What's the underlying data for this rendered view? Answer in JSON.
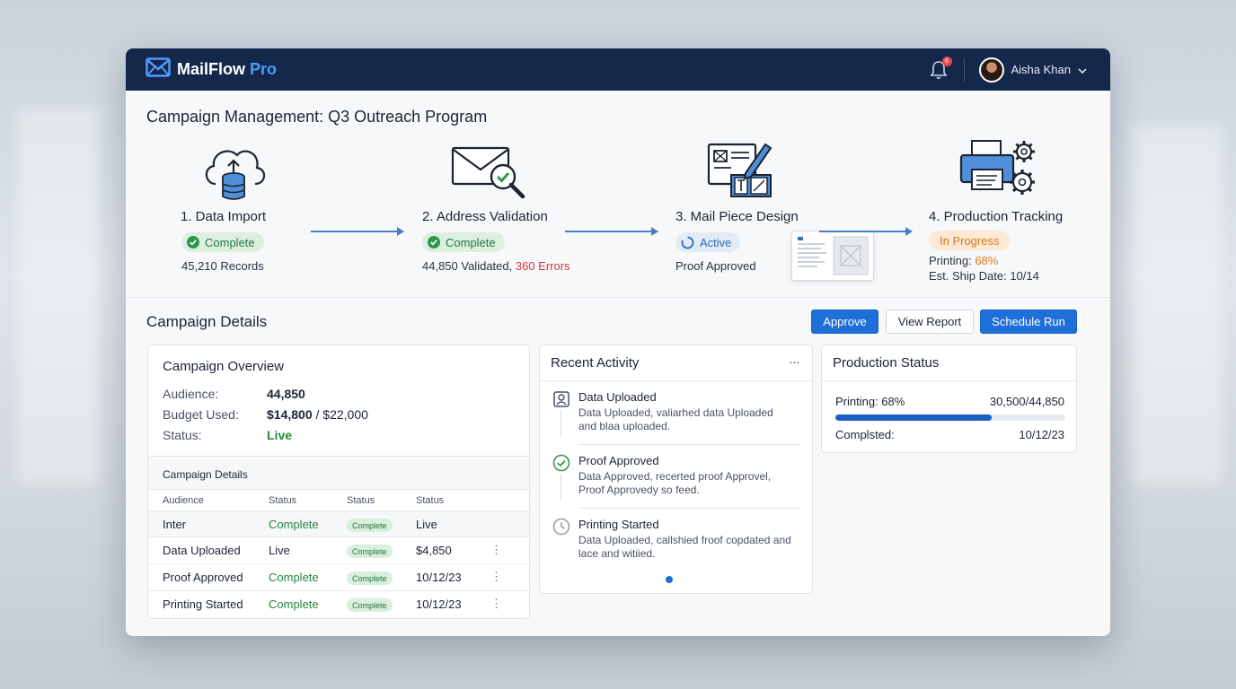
{
  "app": {
    "name": "MailFlow",
    "name_suffix": "Pro",
    "notification_count": "6",
    "user_name": "Aisha Khan"
  },
  "page": {
    "title": "Campaign Management: Q3 Outreach Program"
  },
  "pipeline": {
    "stages": [
      {
        "title": "1. Data Import",
        "status": "Complete",
        "detail": "45,210 Records"
      },
      {
        "title": "2. Address Validation",
        "status": "Complete",
        "detail_validated": "44,850 Validated,",
        "detail_errors": "360 Errors"
      },
      {
        "title": "3. Mail Piece Design",
        "status": "Active",
        "detail": "Proof Approved"
      },
      {
        "title": "4. Production Tracking",
        "status": "In Progress",
        "printing_label": "Printing:",
        "printing_value": "68%",
        "ship_date": "Est. Ship Date: 10/14"
      }
    ]
  },
  "details": {
    "title": "Campaign Details",
    "buttons": {
      "approve": "Approve",
      "view_report": "View Report",
      "schedule_run": "Schedule Run"
    }
  },
  "overview": {
    "title": "Campaign Overview",
    "audience_label": "Audience:",
    "audience_value": "44,850",
    "budget_label": "Budget Used:",
    "budget_used": "$14,800",
    "budget_total": "/ $22,000",
    "status_label": "Status:",
    "status_value": "Live",
    "table_title": "Campaign Details",
    "columns": [
      "Audience",
      "Status",
      "Status",
      "Status"
    ],
    "rows": [
      {
        "name": "Inter",
        "status": "Complete",
        "pill": "Complete",
        "value": "Live",
        "menu": false
      },
      {
        "name": "Data Uploaded",
        "status": "Live",
        "pill": "Complete",
        "value": "$4,850",
        "menu": true
      },
      {
        "name": "Proof Approved",
        "status": "Complete",
        "pill": "Complete",
        "value": "10/12/23",
        "menu": true
      },
      {
        "name": "Printing Started",
        "status": "Complete",
        "pill": "Complete",
        "value": "10/12/23",
        "menu": true
      }
    ]
  },
  "activity": {
    "title": "Recent Activity",
    "more": "···",
    "items": [
      {
        "icon": "user-upload-icon",
        "title": "Data Uploaded",
        "desc": "Data Uploaded, valiarhed data Uploaded and blaa uploaded."
      },
      {
        "icon": "check-circle-icon",
        "title": "Proof Approved",
        "desc": "Data Approved, recerted proof Approvel, Proof Approvedy so feed."
      },
      {
        "icon": "clock-icon",
        "title": "Printing Started",
        "desc": "Data Uploaded, callshied froof copdated and lace and witiied."
      }
    ]
  },
  "production": {
    "title": "Production Status",
    "printing_label": "Printing: 68%",
    "printing_count": "30,500/44,850",
    "progress_fraction": 0.68,
    "completed_label": "Complsted:",
    "completed_date": "10/12/23"
  },
  "colors": {
    "topbar": "#13284a",
    "accent": "#1e6fd9",
    "success": "#23883c",
    "error": "#d2393b",
    "warning": "#e07d1c"
  }
}
